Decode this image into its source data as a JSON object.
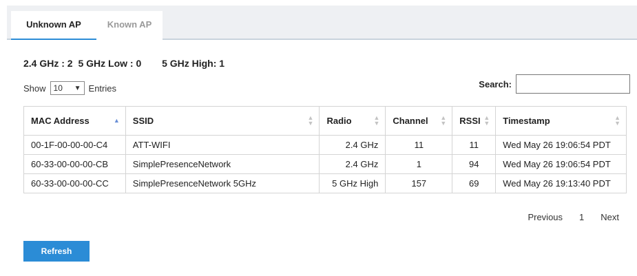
{
  "tabs": [
    {
      "label": "Unknown AP",
      "active": true
    },
    {
      "label": "Known AP",
      "active": false
    }
  ],
  "counts": {
    "ghz24": "2.4 GHz : 2",
    "ghz5_low": "5 GHz Low : 0",
    "ghz5_high": "5 GHz High: 1"
  },
  "length_menu": {
    "prefix": "Show",
    "value": "10",
    "suffix": "Entries"
  },
  "search": {
    "label": "Search:",
    "value": ""
  },
  "table": {
    "columns": [
      "MAC Address",
      "SSID",
      "Radio",
      "Channel",
      "RSSI",
      "Timestamp"
    ],
    "rows": [
      [
        "00-1F-00-00-00-C4",
        "ATT-WIFI",
        "2.4 GHz",
        "11",
        "11",
        "Wed May 26 19:06:54 PDT"
      ],
      [
        "60-33-00-00-00-CB",
        "SimplePresenceNetwork",
        "2.4 GHz",
        "1",
        "94",
        "Wed May 26 19:06:54 PDT"
      ],
      [
        "60-33-00-00-00-CC",
        "SimplePresenceNetwork 5GHz",
        "5 GHz High",
        "157",
        "69",
        "Wed May 26 19:13:40 PDT"
      ]
    ]
  },
  "pagination": {
    "previous": "Previous",
    "page": "1",
    "next": "Next"
  },
  "refresh_label": "Refresh",
  "colors": {
    "accent": "#2b8cd6",
    "tab_bar": "#eef0f3"
  }
}
